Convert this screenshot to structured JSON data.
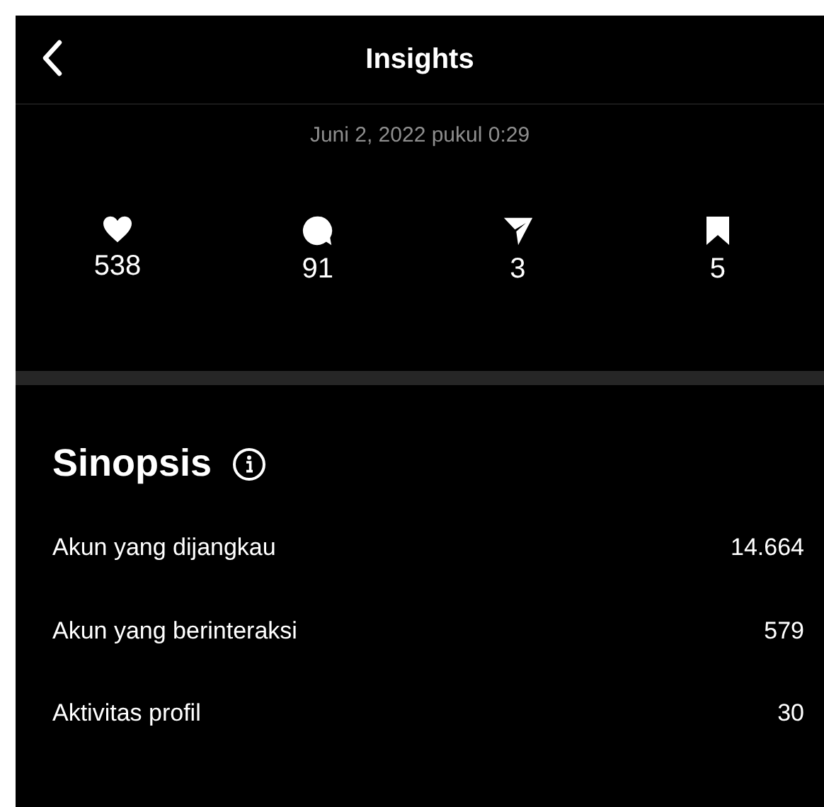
{
  "header": {
    "title": "Insights"
  },
  "post_date": "Juni 2, 2022 pukul 0:29",
  "stats": [
    {
      "kind": "like",
      "value": "538"
    },
    {
      "kind": "comment",
      "value": "91"
    },
    {
      "kind": "share",
      "value": "3"
    },
    {
      "kind": "save",
      "value": "5"
    }
  ],
  "overview": {
    "title": "Sinopsis",
    "rows": [
      {
        "label": "Akun yang dijangkau",
        "value": "14.664"
      },
      {
        "label": "Akun yang berinteraksi",
        "value": "579"
      },
      {
        "label": "Aktivitas profil",
        "value": "30"
      }
    ]
  }
}
